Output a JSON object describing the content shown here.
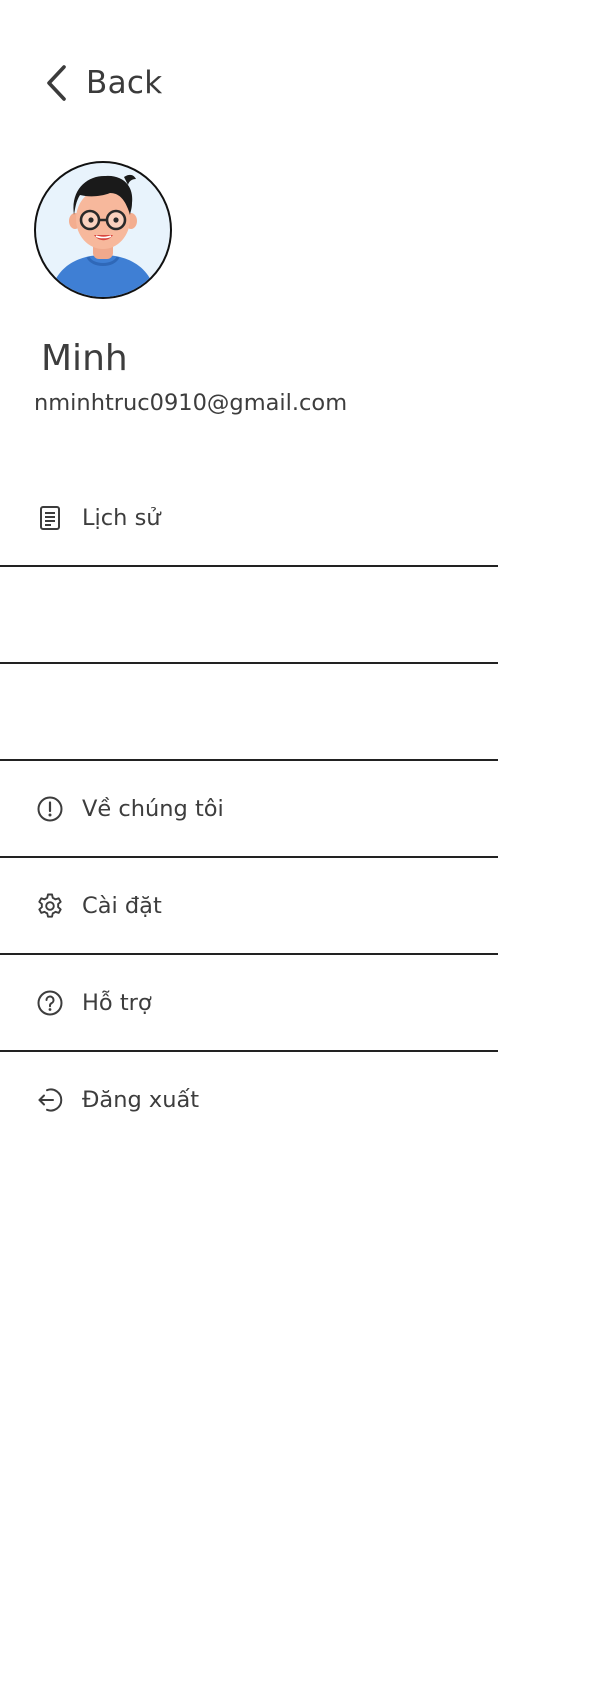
{
  "header": {
    "back_label": "Back"
  },
  "profile": {
    "name": "Minh",
    "email": "nminhtruc0910@gmail.com"
  },
  "menu": {
    "items": [
      {
        "label": "Lịch sử",
        "icon": "history-document-icon"
      },
      {
        "label": "",
        "icon": ""
      },
      {
        "label": "",
        "icon": ""
      },
      {
        "label": "Về chúng tôi",
        "icon": "info-alert-icon"
      },
      {
        "label": "Cài đặt",
        "icon": "gear-icon"
      },
      {
        "label": "Hỗ trợ",
        "icon": "help-question-icon"
      },
      {
        "label": "Đăng xuất",
        "icon": "logout-icon"
      }
    ]
  },
  "colors": {
    "text": "#3d3d3d",
    "divider": "#222222",
    "avatar_bg": "#e8f3fc",
    "avatar_shirt": "#3f7fd4"
  }
}
